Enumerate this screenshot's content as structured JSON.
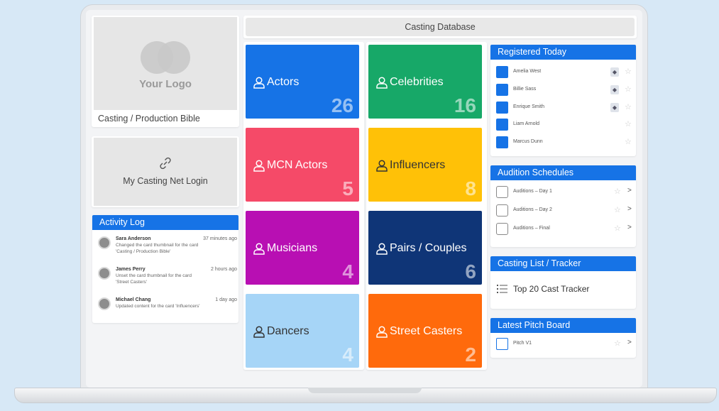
{
  "title_bar": "Casting Database",
  "logo": {
    "text": "Your Logo",
    "caption": "Casting / Production Bible"
  },
  "login": {
    "label": "My Casting Net Login"
  },
  "activity": {
    "header": "Activity Log",
    "items": [
      {
        "name": "Sara Anderson",
        "time": "37 minutes ago",
        "desc": "Changed the card thumbnail for the card 'Casting / Production Bible'"
      },
      {
        "name": "James Perry",
        "time": "2 hours ago",
        "desc": "Unset the card thumbnail for the card 'Street Casters'"
      },
      {
        "name": "Michael Chang",
        "time": "1 day ago",
        "desc": "Updated content for the card 'Influencers'"
      }
    ]
  },
  "tiles": [
    {
      "label": "Actors",
      "count": "26",
      "color": "#1673e6"
    },
    {
      "label": "Celebrities",
      "count": "16",
      "color": "#17a868"
    },
    {
      "label": "MCN Actors",
      "count": "5",
      "color": "#f54a68"
    },
    {
      "label": "Influencers",
      "count": "8",
      "color": "#ffc107"
    },
    {
      "label": "Musicians",
      "count": "4",
      "color": "#b80fb3"
    },
    {
      "label": "Pairs / Couples",
      "count": "6",
      "color": "#0f3577"
    },
    {
      "label": "Dancers",
      "count": "4",
      "color": "#a6d5f7"
    },
    {
      "label": "Street Casters",
      "count": "2",
      "color": "#ff6a0c"
    }
  ],
  "registered": {
    "header": "Registered Today",
    "items": [
      {
        "name": "Amelia West",
        "verified": true
      },
      {
        "name": "Billie Sass",
        "verified": true
      },
      {
        "name": "Enrique Smith",
        "verified": true
      },
      {
        "name": "Liam Arnold",
        "verified": false
      },
      {
        "name": "Marcus Dunn",
        "verified": false
      }
    ]
  },
  "auditions": {
    "header": "Audition Schedules",
    "items": [
      {
        "name": "Auditions – Day 1"
      },
      {
        "name": "Auditions – Day 2"
      },
      {
        "name": "Auditions – Final"
      }
    ]
  },
  "tracker": {
    "header": "Casting List / Tracker",
    "item": "Top 20 Cast Tracker"
  },
  "pitch": {
    "header": "Latest Pitch Board",
    "item": "Pitch V1"
  }
}
